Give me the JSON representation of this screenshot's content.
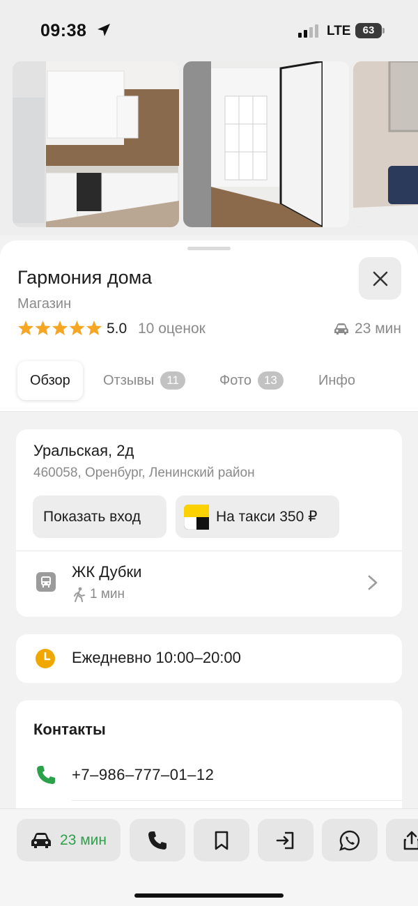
{
  "status_bar": {
    "time": "09:38",
    "network": "LTE",
    "battery": "63"
  },
  "place": {
    "title": "Гармония дома",
    "category": "Магазин",
    "rating": "5.0",
    "rating_count": "10 оценок",
    "drive_time": "23 мин"
  },
  "tabs": [
    {
      "label": "Обзор",
      "active": true
    },
    {
      "label": "Отзывы",
      "count": "11"
    },
    {
      "label": "Фото",
      "count": "13"
    },
    {
      "label": "Инфо"
    }
  ],
  "address": {
    "line1": "Уральская, 2д",
    "line2": "460058, Оренбург, Ленинский район",
    "show_entrance": "Показать вход",
    "taxi": "На такси 350 ₽"
  },
  "transit": {
    "name": "ЖК Дубки",
    "walk": "1 мин"
  },
  "hours": {
    "text": "Ежедневно 10:00–20:00"
  },
  "contacts": {
    "title": "Контакты",
    "phone": "+7‒986‒777‒01‒12"
  },
  "actions": {
    "route_label": "23 мин"
  },
  "colors": {
    "accent_green": "#2ba24a",
    "star": "#f5a623",
    "hours_icon": "#f0a800"
  }
}
